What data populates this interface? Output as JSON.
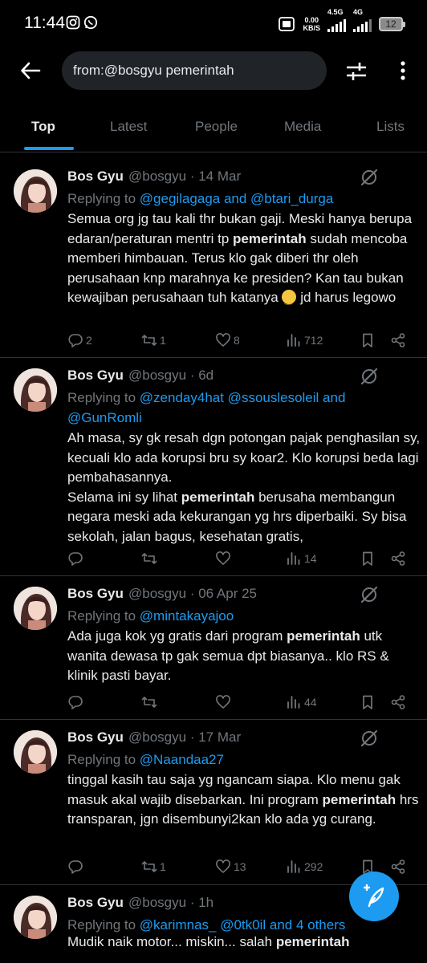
{
  "status_bar": {
    "time": "11:44",
    "net_speed": "0.00",
    "net_unit": "KB/S",
    "signal1": "4.5G",
    "signal2": "4G",
    "battery": "12"
  },
  "search": {
    "value": "from:@bosgyu pemerintah"
  },
  "tabs": [
    "Top",
    "Latest",
    "People",
    "Media",
    "Lists"
  ],
  "tweets": [
    {
      "name": "Bos Gyu",
      "handle": "@bosgyu",
      "time": "14 Mar",
      "replying_label": "Replying to",
      "replying_mentions": "@gegilagaga and @btari_durga",
      "text_html": "Semua org jg tau kali thr bukan gaji. Meski hanya berupa edaran/peraturan mentri tp <b>pemerintah</b> sudah mencoba memberi himbauan. Terus klo gak diberi thr oleh perusahaan knp marahnya ke presiden?  Kan tau bukan kewajiban perusahaan tuh katanya <span class=\"emoji\"></span> jd harus legowo",
      "replies": "2",
      "reposts": "1",
      "likes": "8",
      "views": "712"
    },
    {
      "name": "Bos Gyu",
      "handle": "@bosgyu",
      "time": "6d",
      "replying_label": "Replying to",
      "replying_mentions": "@zenday4hat @ssouslesoleil and @GunRomli",
      "text_html": "Ah masa, sy gk resah dgn potongan pajak penghasilan sy, kecuali klo ada korupsi bru sy koar2. Klo korupsi beda lagi pembahasannya.<br>Selama ini sy lihat <b>pemerintah</b> berusaha membangun negara meski ada kekurangan yg hrs diperbaiki. Sy bisa sekolah, jalan bagus, kesehatan gratis,",
      "replies": "",
      "reposts": "",
      "likes": "",
      "views": "14"
    },
    {
      "name": "Bos Gyu",
      "handle": "@bosgyu",
      "time": "06 Apr 25",
      "replying_label": "Replying to",
      "replying_mentions": "@mintakayajoo",
      "text_html": "Ada juga kok yg gratis dari program <b>pemerintah</b> utk wanita dewasa tp gak semua dpt biasanya.. klo RS &amp; klinik pasti bayar.",
      "replies": "",
      "reposts": "",
      "likes": "",
      "views": "44"
    },
    {
      "name": "Bos Gyu",
      "handle": "@bosgyu",
      "time": "17 Mar",
      "replying_label": "Replying to",
      "replying_mentions": "@Naandaa27",
      "text_html": "tinggal kasih tau saja yg ngancam siapa. Klo menu gak masuk akal wajib disebarkan. Ini program <b>pemerintah</b> hrs transparan, jgn disembunyi2kan klo ada yg curang.",
      "replies": "",
      "reposts": "1",
      "likes": "13",
      "views": "292"
    },
    {
      "name": "Bos Gyu",
      "handle": "@bosgyu",
      "time": "1h",
      "replying_label": "Replying to",
      "replying_mentions": "@karimnas_ @0tk0il and 4 others",
      "text_html": "Mudik naik motor... miskin... salah <b>pemerintah</b>",
      "replies": "",
      "reposts": "",
      "likes": "",
      "views": ""
    }
  ],
  "dot": "·",
  "colors": {
    "accent": "#1d9bf0",
    "background": "#000000",
    "muted": "#71767b",
    "text": "#e7e9ea"
  }
}
